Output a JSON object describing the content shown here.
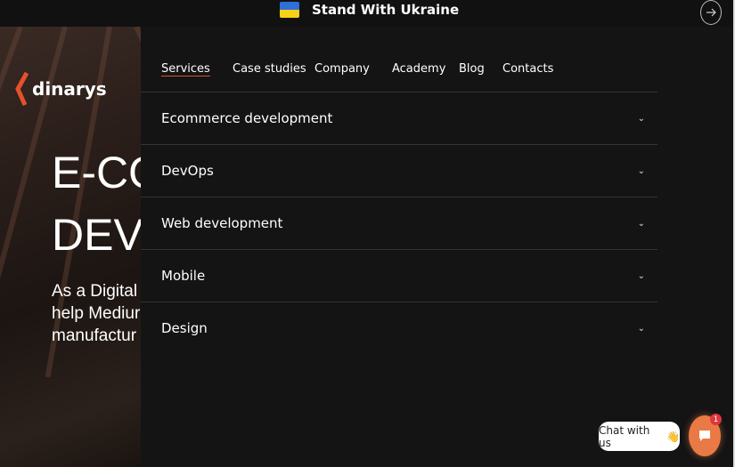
{
  "banner": {
    "text": "Stand With Ukraine",
    "flag_colors": [
      "#2f6fd6",
      "#f7d117"
    ]
  },
  "logo": {
    "text": "dinarys",
    "accent": "#e5512c"
  },
  "hero": {
    "title_line1": "E-CO",
    "title_line2": "DEVE",
    "sub_line1": "As a Digital",
    "sub_line2": "help Mediur",
    "sub_line3": "manufactur"
  },
  "nav": {
    "items": [
      {
        "label": "Services"
      },
      {
        "label": "Case studies"
      },
      {
        "label": "Company"
      },
      {
        "label": "Academy"
      },
      {
        "label": "Blog"
      },
      {
        "label": "Contacts"
      }
    ]
  },
  "services": [
    {
      "label": "Ecommerce development"
    },
    {
      "label": "DevOps"
    },
    {
      "label": "Web development"
    },
    {
      "label": "Mobile"
    },
    {
      "label": "Design"
    }
  ],
  "chat": {
    "label": "Chat with us",
    "emoji": "👋",
    "badge": "1",
    "color": "#ea7a45"
  }
}
